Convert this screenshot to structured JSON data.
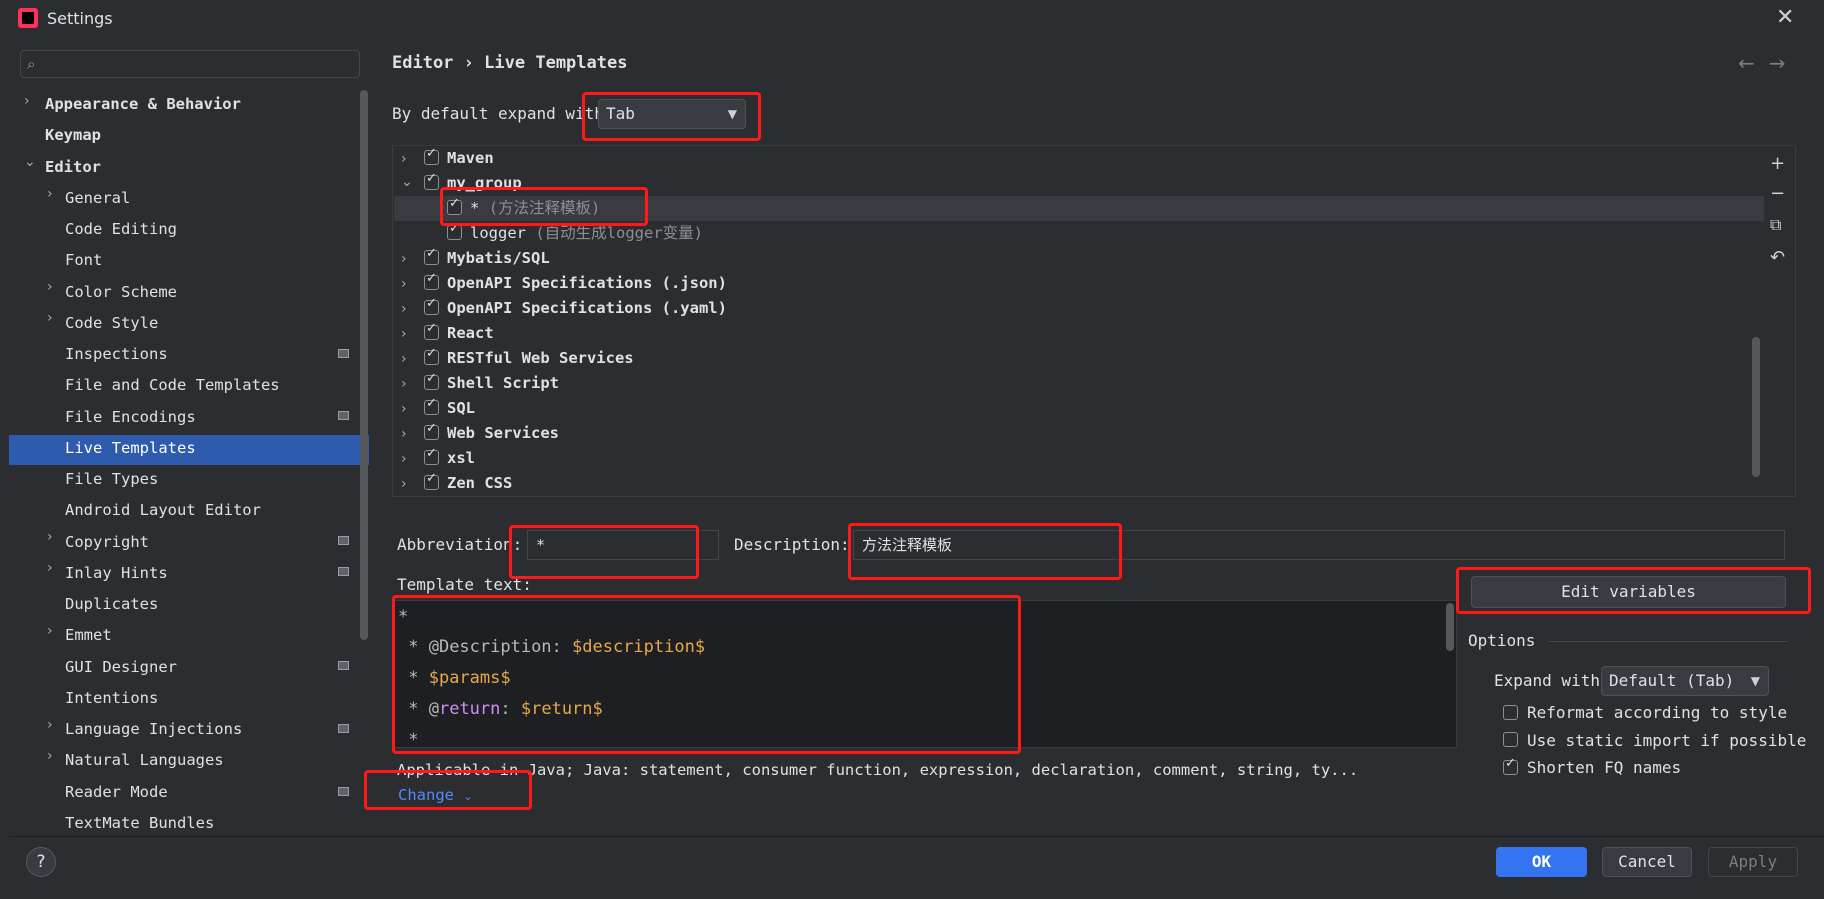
{
  "window": {
    "title": "Settings"
  },
  "search": {
    "placeholder": ""
  },
  "sidebar": {
    "items": [
      {
        "label": "Appearance & Behavior"
      },
      {
        "label": "Keymap"
      },
      {
        "label": "Editor"
      },
      {
        "label": "General"
      },
      {
        "label": "Code Editing"
      },
      {
        "label": "Font"
      },
      {
        "label": "Color Scheme"
      },
      {
        "label": "Code Style"
      },
      {
        "label": "Inspections"
      },
      {
        "label": "File and Code Templates"
      },
      {
        "label": "File Encodings"
      },
      {
        "label": "Live Templates"
      },
      {
        "label": "File Types"
      },
      {
        "label": "Android Layout Editor"
      },
      {
        "label": "Copyright"
      },
      {
        "label": "Inlay Hints"
      },
      {
        "label": "Duplicates"
      },
      {
        "label": "Emmet"
      },
      {
        "label": "GUI Designer"
      },
      {
        "label": "Intentions"
      },
      {
        "label": "Language Injections"
      },
      {
        "label": "Natural Languages"
      },
      {
        "label": "Reader Mode"
      },
      {
        "label": "TextMate Bundles"
      }
    ]
  },
  "header": {
    "crumb_parent": "Editor",
    "crumb_sep": "›",
    "crumb_current": "Live Templates"
  },
  "expand": {
    "label": "By default expand with",
    "value": "Tab"
  },
  "templates": {
    "groups": [
      {
        "name": "Maven"
      },
      {
        "name": "my_group"
      },
      {
        "name": "*",
        "desc": "(方法注释模板)"
      },
      {
        "name": "logger",
        "desc": "(自动生成logger变量)"
      },
      {
        "name": "Mybatis/SQL"
      },
      {
        "name": "OpenAPI Specifications (.json)"
      },
      {
        "name": "OpenAPI Specifications (.yaml)"
      },
      {
        "name": "React"
      },
      {
        "name": "RESTful Web Services"
      },
      {
        "name": "Shell Script"
      },
      {
        "name": "SQL"
      },
      {
        "name": "Web Services"
      },
      {
        "name": "xsl"
      },
      {
        "name": "Zen CSS"
      }
    ]
  },
  "form": {
    "abbreviation_label": "Abbreviation:",
    "abbreviation_value": "*",
    "description_label": "Description:",
    "description_value": "方法注释模板",
    "template_text_label": "Template text:",
    "edit_variables": "Edit variables"
  },
  "code": {
    "l1": "*",
    "l2_star": " * ",
    "l2_tag": "@Description: ",
    "l2_var": "$description$",
    "l3_star": " * ",
    "l3_var": "$params$",
    "l4_star": " * ",
    "l4_at": "@",
    "l4_kw": "return",
    "l4_colon": ": ",
    "l4_var": "$return$",
    "l5": " *"
  },
  "options": {
    "title": "Options",
    "expand_with_label": "Expand with",
    "expand_with_value": "Default (Tab)",
    "reformat": "Reformat according to style",
    "static_import": "Use static import if possible",
    "shorten_fq": "Shorten FQ names"
  },
  "applicable": "Applicable in Java; Java: statement, consumer function, expression, declaration, comment, string, ty...",
  "change": "Change",
  "buttons": {
    "help": "?",
    "ok": "OK",
    "cancel": "Cancel",
    "apply": "Apply"
  },
  "icons": {
    "add": "+",
    "remove": "−",
    "copy": "⧉",
    "restore": "↶",
    "back": "←",
    "forward": "→",
    "close": "✕"
  }
}
